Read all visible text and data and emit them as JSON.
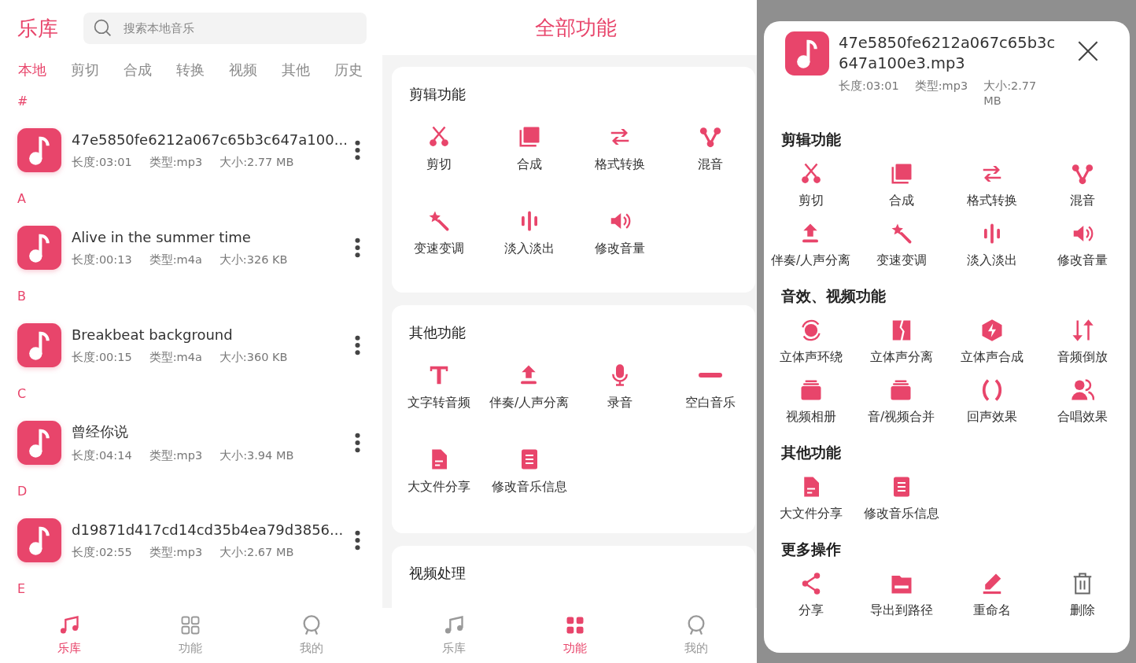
{
  "library_screen": {
    "title": "乐库",
    "search": {
      "placeholder": "搜索本地音乐"
    },
    "tabs": [
      {
        "label": "本地",
        "selected": true
      },
      {
        "label": "剪切",
        "selected": false
      },
      {
        "label": "合成",
        "selected": false
      },
      {
        "label": "转换",
        "selected": false
      },
      {
        "label": "视频",
        "selected": false
      },
      {
        "label": "其他",
        "selected": false
      },
      {
        "label": "历史",
        "selected": false
      }
    ],
    "sections": [
      {
        "letter": "#",
        "songs": [
          {
            "title": "47e5850fe6212a067c65b3c647a100...",
            "duration": "长度:03:01",
            "type": "类型:mp3",
            "size": "大小:2.77 MB"
          }
        ]
      },
      {
        "letter": "A",
        "songs": [
          {
            "title": "Alive in the summer time",
            "duration": "长度:00:13",
            "type": "类型:m4a",
            "size": "大小:326 KB"
          }
        ]
      },
      {
        "letter": "B",
        "songs": [
          {
            "title": "Breakbeat background",
            "duration": "长度:00:15",
            "type": "类型:m4a",
            "size": "大小:360 KB"
          }
        ]
      },
      {
        "letter": "C",
        "songs": [
          {
            "title": "曾经你说",
            "duration": "长度:04:14",
            "type": "类型:mp3",
            "size": "大小:3.94 MB"
          }
        ]
      },
      {
        "letter": "D",
        "songs": [
          {
            "title": "d19871d417cd14cd35b4ea79d3856...",
            "duration": "长度:02:55",
            "type": "类型:mp3",
            "size": "大小:2.67 MB"
          }
        ]
      },
      {
        "letter": "E"
      }
    ],
    "bottom_nav": [
      {
        "label": "乐库",
        "selected": true
      },
      {
        "label": "功能",
        "selected": false
      },
      {
        "label": "我的",
        "selected": false
      }
    ]
  },
  "functions_screen": {
    "title": "全部功能",
    "cards": [
      {
        "heading": "剪辑功能",
        "items": [
          "剪切",
          "合成",
          "格式转换",
          "混音",
          "变速变调",
          "淡入淡出",
          "修改音量"
        ]
      },
      {
        "heading": "其他功能",
        "items": [
          "文字转音频",
          "伴奏/人声分离",
          "录音",
          "空白音乐",
          "大文件分享",
          "修改音乐信息"
        ]
      },
      {
        "heading": "视频处理"
      }
    ],
    "bottom_nav": [
      {
        "label": "乐库",
        "selected": false
      },
      {
        "label": "功能",
        "selected": true
      },
      {
        "label": "我的",
        "selected": false
      }
    ]
  },
  "detail_sheet": {
    "file_name": "47e5850fe6212a067c65b3c647a100e3.mp3",
    "duration": "长度:03:01",
    "type": "类型:mp3",
    "size": "大小:2.77 MB",
    "sections": [
      {
        "heading": "剪辑功能",
        "items": [
          "剪切",
          "合成",
          "格式转换",
          "混音",
          "伴奏/人声分离",
          "变速变调",
          "淡入淡出",
          "修改音量"
        ]
      },
      {
        "heading": "音效、视频功能",
        "items": [
          "立体声环绕",
          "立体声分离",
          "立体声合成",
          "音频倒放",
          "视频相册",
          "音/视频合并",
          "回声效果",
          "合唱效果"
        ]
      },
      {
        "heading": "其他功能",
        "items": [
          "大文件分享",
          "修改音乐信息"
        ]
      },
      {
        "heading": "更多操作",
        "items": [
          "分享",
          "导出到路径",
          "重命名",
          "删除"
        ]
      }
    ]
  }
}
